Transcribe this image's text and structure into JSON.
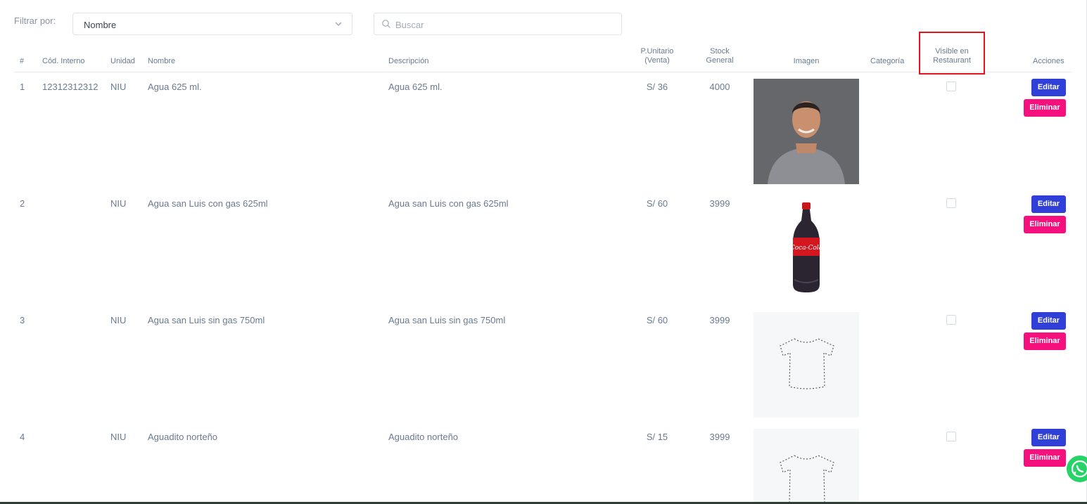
{
  "filter": {
    "label": "Filtrar por:",
    "selected": "Nombre"
  },
  "search": {
    "placeholder": "Buscar",
    "value": ""
  },
  "table": {
    "headers": {
      "index": "#",
      "code": "Cód. Interno",
      "unit": "Unidad",
      "name": "Nombre",
      "description": "Descripción",
      "price_line1": "P.Unitario",
      "price_line2": "(Venta)",
      "stock_line1": "Stock",
      "stock_line2": "General",
      "image": "Imagen",
      "category": "Categoría",
      "visible_line1": "Visible en",
      "visible_line2": "Restaurant",
      "actions": "Acciones"
    },
    "rows": [
      {
        "index": "1",
        "code": "12312312312",
        "unit": "NIU",
        "name": "Agua 625 ml.",
        "description": "Agua 625 ml.",
        "price": "S/ 36",
        "stock": "4000",
        "image": "person-photo",
        "category": "",
        "visible": false
      },
      {
        "index": "2",
        "code": "",
        "unit": "NIU",
        "name": "Agua san Luis con gas 625ml",
        "description": "Agua san Luis con gas 625ml",
        "price": "S/ 60",
        "stock": "3999",
        "image": "cola-bottle",
        "category": "",
        "visible": false
      },
      {
        "index": "3",
        "code": "",
        "unit": "NIU",
        "name": "Agua san Luis sin gas 750ml",
        "description": "Agua san Luis sin gas 750ml",
        "price": "S/ 60",
        "stock": "3999",
        "image": "tshirt-placeholder",
        "category": "",
        "visible": false
      },
      {
        "index": "4",
        "code": "",
        "unit": "NIU",
        "name": "Aguadito norteño",
        "description": "Aguadito norteño",
        "price": "S/ 15",
        "stock": "3999",
        "image": "tshirt-placeholder",
        "category": "",
        "visible": false
      }
    ],
    "edit_label": "Editar",
    "delete_label": "Eliminar"
  },
  "colors": {
    "edit": "#2f3fd8",
    "delete": "#f5107e",
    "highlight": "#e3141c",
    "whatsapp": "#25d366"
  }
}
